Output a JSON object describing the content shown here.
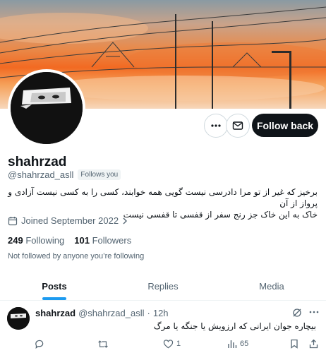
{
  "profile": {
    "display_name": "shahrzad",
    "handle": "@shahrzad_asll",
    "follows_you_badge": "Follows you",
    "bio_line1": "برخیز که غیر از تو مرا دادرسی نیست گویی همه خوابند، کسی را به کسی نیست آزادی و پرواز از آن",
    "bio_line2": "خاک به این خاک جز رنج سفر از قفسی تا قفسی نیست",
    "joined": "Joined September 2022",
    "following_count": "249",
    "following_label": "Following",
    "followers_count": "101",
    "followers_label": "Followers",
    "not_followed_text": "Not followed by anyone you’re following"
  },
  "actions": {
    "more_icon": "more-horizontal-icon",
    "message_icon": "envelope-icon",
    "follow_back_label": "Follow back"
  },
  "tabs": [
    {
      "label": "Posts",
      "active": true
    },
    {
      "label": "Replies",
      "active": false
    },
    {
      "label": "Media",
      "active": false
    }
  ],
  "tweet": {
    "name": "shahrzad",
    "handle": "@shahrzad_asll",
    "separator": "·",
    "time": "12h",
    "text": "بیچاره جوان ایرانی که ارزویش یا جنگه یا مرگ",
    "likes": "1",
    "views": "65"
  },
  "colors": {
    "accent": "#1d9bf0",
    "button_dark": "#0f1419",
    "muted_text": "#536471"
  }
}
